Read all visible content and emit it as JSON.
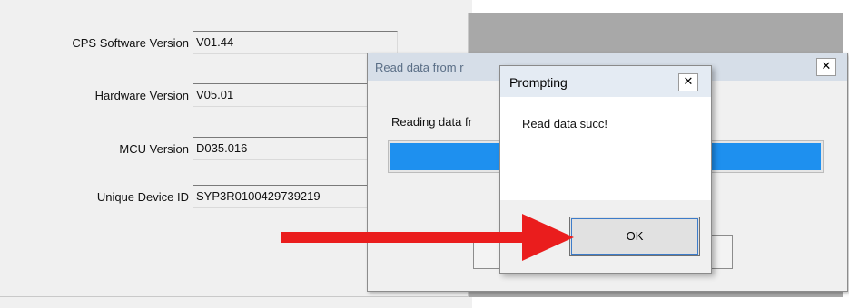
{
  "main": {
    "fields": [
      {
        "label": "CPS Software Version",
        "value": "V01.44"
      },
      {
        "label": "Hardware Version",
        "value": "V05.01"
      },
      {
        "label": "MCU Version",
        "value": "D035.016"
      },
      {
        "label": "Unique Device ID",
        "value": "SYP3R0100429739219"
      }
    ]
  },
  "read_dialog": {
    "title": "Read data from r",
    "status": "Reading data fr",
    "progress_percent": 100,
    "close_glyph": "✕"
  },
  "prompt": {
    "title": "Prompting",
    "close_glyph": "✕",
    "message": "Read data succ!",
    "ok_label": "OK"
  },
  "colors": {
    "progress": "#1e90ef",
    "arrow": "#ea1d1d",
    "titlebar_inactive": "#d6dee8"
  }
}
